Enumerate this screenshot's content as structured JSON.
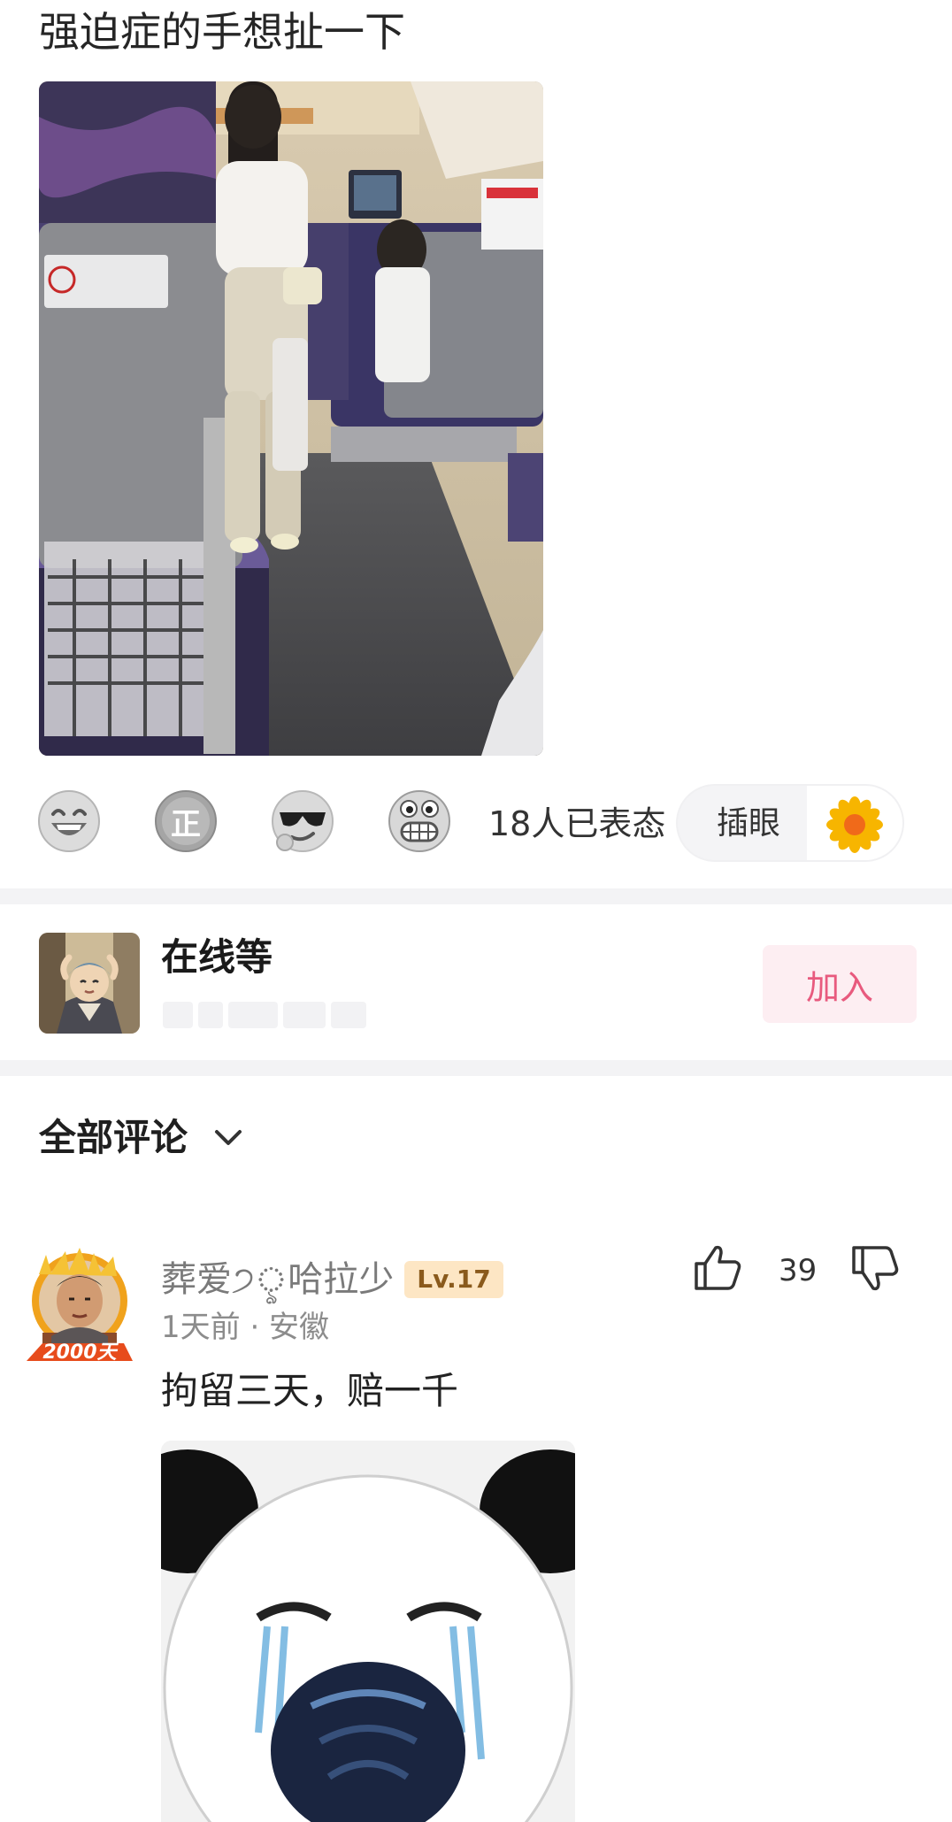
{
  "post": {
    "title": "强迫症的手想扯一下"
  },
  "reactions": {
    "emojis": [
      {
        "icon": "laughing-face-icon"
      },
      {
        "icon": "zheng-badge-icon",
        "glyph": "正"
      },
      {
        "icon": "sunglasses-face-icon"
      },
      {
        "icon": "grinning-teeth-face-icon"
      }
    ],
    "count_text": "18人已表态",
    "pill_label": "插眼",
    "pill_icon": "sunflower-icon"
  },
  "group": {
    "name": "在线等",
    "join_label": "加入",
    "accent": "#e85a7e"
  },
  "comments_header": {
    "label": "全部评论",
    "icon": "chevron-down-icon"
  },
  "comment": {
    "username": "葬爱੭ৢ哈拉少",
    "level": "Lv.17",
    "badge_text": "2000天",
    "meta": "1天前 · 安徽",
    "text": "拘留三天，赔一千",
    "like_count": "39"
  }
}
